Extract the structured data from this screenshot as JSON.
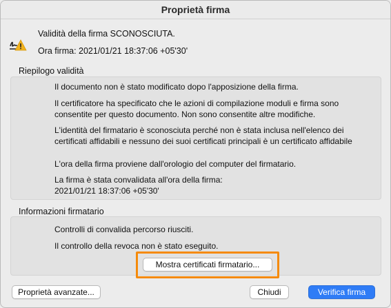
{
  "window": {
    "title": "Proprietà firma"
  },
  "header": {
    "status": "Validità della firma SCONOSCIUTA.",
    "time": "Ora firma: 2021/01/21 18:37:06 +05'30'",
    "icon": "signature-warning-icon"
  },
  "summary": {
    "title": "Riepilogo validità",
    "p1": "Il documento non è stato modificato dopo l'apposizione della firma.",
    "p2": "Il certificatore ha specificato che le azioni di compilazione moduli e firma sono consentite per questo documento. Non sono consentite altre modifiche.",
    "p3": "L'identità del firmatario è sconosciuta perché non è stata inclusa nell'elenco dei certificati affidabili e nessuno dei suoi certificati principali è un certificato affidabile",
    "p4": "L'ora della firma proviene dall'orologio del computer del firmatario.",
    "p5": "La firma è stata convalidata all'ora della firma: 2021/01/21 18:37:06 +05'30'"
  },
  "signer": {
    "title": "Informazioni firmatario",
    "p1": "Controlli di convalida percorso riusciti.",
    "p2": "Il controllo della revoca non è stato eseguito.",
    "show_certs": "Mostra certificati firmatario..."
  },
  "footer": {
    "advanced": "Proprietà avanzate...",
    "close": "Chiudi",
    "verify": "Verifica firma"
  },
  "colors": {
    "highlight": "#f58a0a",
    "primary": "#2f7cf6"
  }
}
